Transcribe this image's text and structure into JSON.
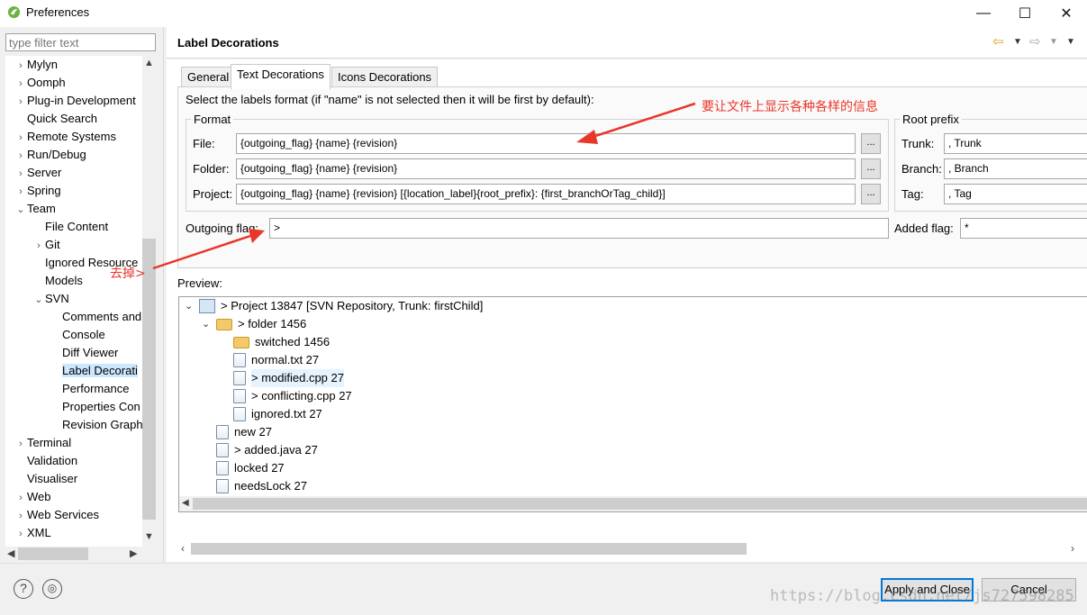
{
  "window": {
    "title": "Preferences",
    "min_glyph": "—",
    "max_glyph": "☐",
    "close_glyph": "✕"
  },
  "filter": {
    "placeholder": "type filter text"
  },
  "tree": [
    {
      "label": "Mylyn",
      "twisty": "›"
    },
    {
      "label": "Oomph",
      "twisty": "›"
    },
    {
      "label": "Plug-in Development",
      "twisty": "›"
    },
    {
      "label": "Quick Search",
      "twisty": ""
    },
    {
      "label": "Remote Systems",
      "twisty": "›"
    },
    {
      "label": "Run/Debug",
      "twisty": "›"
    },
    {
      "label": "Server",
      "twisty": "›"
    },
    {
      "label": "Spring",
      "twisty": "›"
    },
    {
      "label": "Team",
      "twisty": "⌄"
    },
    {
      "label": "File Content",
      "twisty": ""
    },
    {
      "label": "Git",
      "twisty": "›"
    },
    {
      "label": "Ignored Resource",
      "twisty": ""
    },
    {
      "label": "Models",
      "twisty": ""
    },
    {
      "label": "SVN",
      "twisty": "⌄"
    },
    {
      "label": "Comments and",
      "twisty": ""
    },
    {
      "label": "Console",
      "twisty": ""
    },
    {
      "label": "Diff Viewer",
      "twisty": ""
    },
    {
      "label": "Label Decorati",
      "twisty": ""
    },
    {
      "label": "Performance",
      "twisty": ""
    },
    {
      "label": "Properties Con",
      "twisty": ""
    },
    {
      "label": "Revision Graph",
      "twisty": ""
    },
    {
      "label": "Terminal",
      "twisty": "›"
    },
    {
      "label": "Validation",
      "twisty": ""
    },
    {
      "label": "Visualiser",
      "twisty": ""
    },
    {
      "label": "Web",
      "twisty": "›"
    },
    {
      "label": "Web Services",
      "twisty": "›"
    },
    {
      "label": "XML",
      "twisty": "›"
    }
  ],
  "page": {
    "title": "Label Decorations"
  },
  "tabs": [
    "General",
    "Text Decorations",
    "Icons Decorations"
  ],
  "intro": "Select the labels format (if \"name\" is not selected then it will be first by default):",
  "format": {
    "title": "Format",
    "file_label": "File:",
    "file_value": "{outgoing_flag} {name} {revision}",
    "folder_label": "Folder:",
    "folder_value": "{outgoing_flag} {name} {revision}",
    "project_label": "Project:",
    "project_value": "{outgoing_flag} {name} {revision} [{location_label}{root_prefix}: {first_branchOrTag_child}]",
    "browse": "..."
  },
  "root_prefix": {
    "title": "Root prefix",
    "trunk_label": "Trunk:",
    "trunk_value": ", Trunk",
    "branch_label": "Branch:",
    "branch_value": ", Branch",
    "tag_label": "Tag:",
    "tag_value": ", Tag"
  },
  "outgoing": {
    "label": "Outgoing flag:",
    "value": ">"
  },
  "added": {
    "label": "Added flag:",
    "value": "*"
  },
  "preview": {
    "label": "Preview:",
    "items": [
      {
        "text": "> Project 13847 [SVN Repository, Trunk: firstChild]",
        "icon": "project-icon"
      },
      {
        "text": "> folder 1456",
        "icon": "folder-icon"
      },
      {
        "text": "switched 1456",
        "icon": "folder-icon"
      },
      {
        "text": "normal.txt 27",
        "icon": "file-icon"
      },
      {
        "text": "> modified.cpp 27",
        "icon": "file-icon"
      },
      {
        "text": "> conflicting.cpp 27",
        "icon": "file-icon"
      },
      {
        "text": "ignored.txt 27",
        "icon": "file-icon"
      },
      {
        "text": "new 27",
        "icon": "file-icon"
      },
      {
        "text": "> added.java 27",
        "icon": "file-icon"
      },
      {
        "text": "locked 27",
        "icon": "file-icon"
      },
      {
        "text": "needsLock 27",
        "icon": "file-icon"
      }
    ]
  },
  "buttons": {
    "apply_close": "Apply and Close",
    "cancel": "Cancel",
    "help": "?",
    "import": "◎"
  },
  "annotations": {
    "note1": "要让文件上显示各种各样的信息",
    "note2": "去掉>"
  },
  "watermark": "https://blog.csdn.net/js727598285",
  "colors": {
    "annotation": "#e8362a",
    "selection": "#cce8ff",
    "primary_border": "#0078d7"
  }
}
